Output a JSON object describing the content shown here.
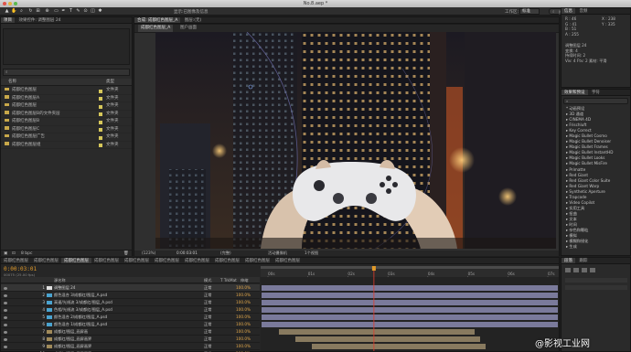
{
  "window": {
    "title": "No.8.aep *"
  },
  "toolbar": {
    "workspace_label": "工作区:",
    "workspace_value": "标准",
    "search_placeholder": "搜索帮助",
    "center_label": "显示:已图像及信息"
  },
  "info_panel": {
    "tabs": [
      "信息",
      "音频"
    ],
    "lines": [
      "R : 46",
      "G : 41",
      "B : 51",
      "A : 255",
      "X : 238",
      "Y : 335"
    ],
    "comp_lines": [
      "调整图层 24",
      "变换: 4",
      "持续时间: 2",
      "Viv: 4 Ftv: 2 素材: 平滑"
    ]
  },
  "project_panel": {
    "tabs": [
      "项目",
      "效果控件: 调整图层 24"
    ],
    "search_placeholder": "",
    "header": {
      "name": "名称",
      "type": "类型"
    },
    "rows": [
      {
        "name": "成都红色图层",
        "type": "文件夹"
      },
      {
        "name": "成都红色图层A",
        "type": "文件夹"
      },
      {
        "name": "成都红色图层",
        "type": "文件夹"
      },
      {
        "name": "成都红色图层B的文件夹层",
        "type": "文件夹"
      },
      {
        "name": "成都红色图层B",
        "type": "文件夹"
      },
      {
        "name": "成都红色图层C",
        "type": "文件夹"
      },
      {
        "name": "成都红色图层广告",
        "type": "文件夹"
      },
      {
        "name": "成都红色图层组",
        "type": "文件夹"
      }
    ],
    "footer_bpc": "8 bpc"
  },
  "composition_panel": {
    "tabs": [
      "合成: 成都红色图层_A",
      "图层:(无)"
    ],
    "breadcrumb": [
      "成都红色图层_A",
      "图户画面"
    ],
    "zoom": "(123%)",
    "timecode": "0:00:03:01",
    "resolution": "(完整)",
    "view": "活动摄像机",
    "view_count": "1个视图"
  },
  "effects_panel": {
    "tabs": [
      "效果和预设",
      "字符"
    ],
    "items": [
      "* 动画预设",
      "▸ 3D 通道",
      "▸ CINEMA 4D",
      "▸ Frischluft",
      "▸ Key Correct",
      "▸ Magic Bullet Cosmo",
      "▸ Magic Bullet Denoiser",
      "▸ Magic Bullet Frames",
      "▸ Magic Bullet InstantHD",
      "▸ Magic Bullet Looks",
      "▸ Magic Bullet MisFire",
      "▸ Primatte",
      "▸ Red Giant",
      "▸ Red Giant Color Suite",
      "▸ Red Giant Warp",
      "▸ Synthetic Aperture",
      "▸ Trapcode",
      "▸ Video Copilot",
      "▸ 实用工具",
      "▸ 扭曲",
      "▸ 文本",
      "▸ 时间",
      "▸ 杂色和颗粒",
      "▸ 模拟",
      "▸ 模糊和锐化",
      "▸ 生成"
    ]
  },
  "paragraph_panel": {
    "tabs": [
      "段落",
      "跟踪"
    ]
  },
  "timeline": {
    "timecode": "0:00:03:01",
    "frames": "00075 (25.00 fps)",
    "tabs": [
      "成都红色图层",
      "成都红色图层",
      "成都红色图层",
      "成都红色图层",
      "成都红色图层",
      "成都红色图层",
      "成都红色图层",
      "成都红色图层",
      "成都红色图层",
      "成都红色图层"
    ],
    "header": {
      "name": "源名称",
      "mode": "模式",
      "trkmat": "T TrkMat",
      "stretch": "伸缩"
    },
    "ruler_labels": [
      "00s",
      "01s",
      "02s",
      "03s",
      "04s",
      "05s",
      "06s",
      "07s"
    ],
    "layers": [
      {
        "num": "1",
        "name": "调整图层 24",
        "mode": "正常",
        "pct": "100.0%",
        "color": "#e0e0e0"
      },
      {
        "num": "2",
        "name": "颜色混合 3/成都红/图层_A.psd",
        "mode": "正常",
        "pct": "100.0%",
        "color": "#4aa3d0"
      },
      {
        "num": "3",
        "name": "高速/光线流 3/成都红/图层_A.psd",
        "mode": "正常",
        "pct": "100.0%",
        "color": "#4aa3d0"
      },
      {
        "num": "4",
        "name": "色相/光线流 3/成都红/图层_A.psd",
        "mode": "正常",
        "pct": "100.0%",
        "color": "#4aa3d0"
      },
      {
        "num": "5",
        "name": "颜色混合 2/成都红/图层_A.psd",
        "mode": "正常",
        "pct": "100.0%",
        "color": "#4aa3d0"
      },
      {
        "num": "6",
        "name": "颜色混合 1/成都红/图层_A.psd",
        "mode": "正常",
        "pct": "100.0%",
        "color": "#4aa3d0"
      },
      {
        "num": "7",
        "name": "成都红/图层_画屏画",
        "mode": "正常",
        "pct": "100.0%",
        "color": "#a08a5a"
      },
      {
        "num": "8",
        "name": "成都红/图层_画屏画界",
        "mode": "正常",
        "pct": "100.0%",
        "color": "#a08a5a"
      },
      {
        "num": "9",
        "name": "成都红/图层_画屏画界",
        "mode": "正常",
        "pct": "100.0%",
        "color": "#a08a5a"
      },
      {
        "num": "10",
        "name": "成都红/图层_画屏画界",
        "mode": "正常",
        "pct": "100.0%",
        "color": "#a08a5a"
      }
    ],
    "playhead_fraction": 0.38
  },
  "watermark": "@影视工业网",
  "colors": {
    "accent_orange": "#e09a2a",
    "playhead": "#e23b2b",
    "bar_purple": "#8a8ab0",
    "bar_tan": "#9a8a6a"
  }
}
